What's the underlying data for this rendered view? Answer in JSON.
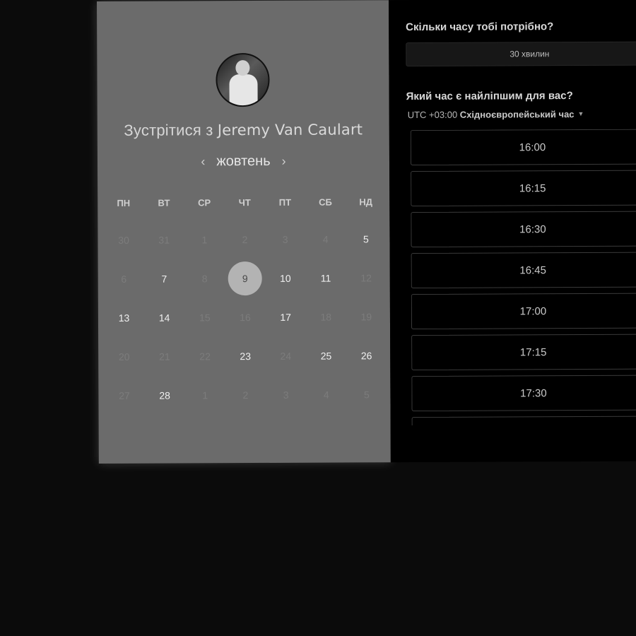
{
  "host": {
    "prefix": "Зустрітися з",
    "name": "Jeremy Van Caulart"
  },
  "calendar": {
    "month": "жовтень",
    "prev_arrow": "‹",
    "next_arrow": "›",
    "weekdays": [
      "ПН",
      "ВТ",
      "СР",
      "ЧТ",
      "ПТ",
      "СБ",
      "НД"
    ],
    "days": [
      {
        "label": "30",
        "state": "muted"
      },
      {
        "label": "31",
        "state": "muted"
      },
      {
        "label": "1",
        "state": "muted"
      },
      {
        "label": "2",
        "state": "muted"
      },
      {
        "label": "3",
        "state": "muted"
      },
      {
        "label": "4",
        "state": "muted"
      },
      {
        "label": "5",
        "state": "avail"
      },
      {
        "label": "6",
        "state": "muted"
      },
      {
        "label": "7",
        "state": "avail"
      },
      {
        "label": "8",
        "state": "muted"
      },
      {
        "label": "9",
        "state": "selected"
      },
      {
        "label": "10",
        "state": "avail"
      },
      {
        "label": "11",
        "state": "avail"
      },
      {
        "label": "12",
        "state": "muted"
      },
      {
        "label": "13",
        "state": "avail"
      },
      {
        "label": "14",
        "state": "avail"
      },
      {
        "label": "15",
        "state": "muted"
      },
      {
        "label": "16",
        "state": "muted"
      },
      {
        "label": "17",
        "state": "avail"
      },
      {
        "label": "18",
        "state": "muted"
      },
      {
        "label": "19",
        "state": "muted"
      },
      {
        "label": "20",
        "state": "muted"
      },
      {
        "label": "21",
        "state": "muted"
      },
      {
        "label": "22",
        "state": "muted"
      },
      {
        "label": "23",
        "state": "avail"
      },
      {
        "label": "24",
        "state": "muted"
      },
      {
        "label": "25",
        "state": "avail"
      },
      {
        "label": "26",
        "state": "avail"
      },
      {
        "label": "27",
        "state": "muted"
      },
      {
        "label": "28",
        "state": "avail"
      },
      {
        "label": "1",
        "state": "muted"
      },
      {
        "label": "2",
        "state": "muted"
      },
      {
        "label": "3",
        "state": "muted"
      },
      {
        "label": "4",
        "state": "muted"
      },
      {
        "label": "5",
        "state": "muted"
      }
    ]
  },
  "booking": {
    "duration_question": "Скільки часу тобі потрібно?",
    "duration_value": "30 хвилин",
    "time_question": "Який час є найліпшим для вас?",
    "timezone_offset": "UTC +03:00",
    "timezone_name": "Східноєвропейський час",
    "slots": [
      "16:00",
      "16:15",
      "16:30",
      "16:45",
      "17:00",
      "17:15",
      "17:30",
      ""
    ]
  },
  "icons": {
    "timezone_caret": "caret-down-icon",
    "prev_month": "chevron-left-icon",
    "next_month": "chevron-right-icon"
  },
  "colors": {
    "left_panel_bg": "#6b6b6b",
    "right_panel_bg": "#000000",
    "page_bg": "#0b0b0b",
    "selected_day": "#b3b3b3"
  }
}
